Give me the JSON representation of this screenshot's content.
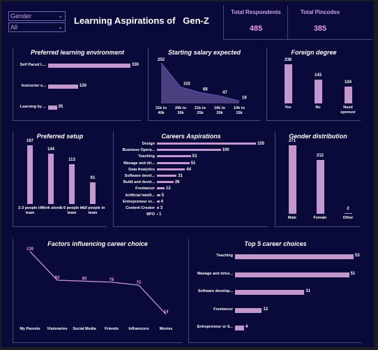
{
  "filters": {
    "gender_label": "Gender",
    "gender_value": "All"
  },
  "header": {
    "title": "Learning Aspirations of   Gen-Z"
  },
  "kpis": {
    "respondents_label": "Total Respondents",
    "respondents_value": "485",
    "pincodes_label": "Total Pincodes",
    "pincodes_value": "385"
  },
  "colors": {
    "bar": "#c597cf",
    "background": "#09093a",
    "salary_fill": "#4b3f80"
  },
  "chart_data": [
    {
      "type": "bar",
      "title": "Preferred learning environment",
      "orientation": "horizontal",
      "categories": [
        "Self Paced L...",
        "Instructor o...",
        "Learning by ..."
      ],
      "values": [
        330,
        120,
        35
      ]
    },
    {
      "type": "area",
      "title": "Starting salary expected",
      "categories": [
        "31k to 40k",
        "26k to 30k",
        "21k to 25k",
        "16k to 20k",
        "10k to 15k"
      ],
      "values": [
        252,
        102,
        68,
        47,
        16
      ]
    },
    {
      "type": "bar",
      "title": "Foreign degree",
      "categories": [
        "Yes",
        "No",
        "Need sponsor"
      ],
      "values": [
        238,
        143,
        104
      ]
    },
    {
      "type": "bar",
      "title": "Preferred setup",
      "categories": [
        "2-3 people in team",
        "Work alone",
        "5-6 people in team",
        ">10 people in team"
      ],
      "values": [
        167,
        144,
        113,
        61
      ]
    },
    {
      "type": "bar",
      "title": "Careers Aspirations",
      "orientation": "horizontal",
      "categories": [
        "Design",
        "Business Opera...",
        "Teaching",
        "Manage and dri...",
        "Data Analytics",
        "Software devel...",
        "Build and devel...",
        "Freelancer",
        "Artificial Intelli...",
        "Entrepreneur or...",
        "Content Creator",
        "BPO"
      ],
      "values": [
        155,
        100,
        53,
        51,
        44,
        31,
        26,
        12,
        5,
        4,
        3,
        1
      ]
    },
    {
      "type": "bar",
      "title": "Gender distribution",
      "categories": [
        "Male",
        "Female",
        "Other"
      ],
      "values": [
        271,
        212,
        2
      ]
    },
    {
      "type": "line",
      "title": "Factors influencing career choice",
      "categories": [
        "My Parents",
        "Visionaries",
        "Social Media",
        "Friends",
        "Influencers",
        "Movies"
      ],
      "values": [
        139,
        82,
        80,
        78,
        72,
        14
      ]
    },
    {
      "type": "bar",
      "title": "Top 5 career choices",
      "orientation": "horizontal",
      "categories": [
        "Teaching",
        "Manage and drive...",
        "Software develop...",
        "Freelancer",
        "Entrepreneur or S..."
      ],
      "values": [
        53,
        51,
        31,
        12,
        4
      ]
    }
  ]
}
